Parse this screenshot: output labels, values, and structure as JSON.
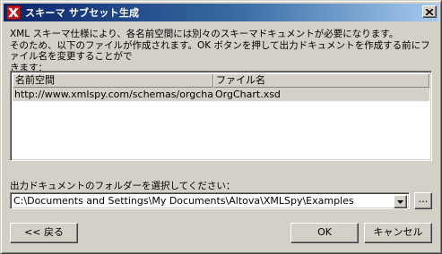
{
  "window": {
    "title": "スキーマ サブセット生成",
    "icon": "xmlspy-app-icon",
    "close_icon": "close-icon"
  },
  "description": "XML スキーマ仕様により、各名前空間には別々のスキーマドキュメントが必要になります。\nそのため、以下のファイルが作成されます。OK ボタンを押して出力ドキュメントを作成する前にファイル名を変更することがで\nきます：",
  "table": {
    "columns": [
      "名前空間",
      "ファイル名"
    ],
    "rows": [
      {
        "namespace": "http://www.xmlspy.com/schemas/orgchart",
        "filename": "OrgChart.xsd"
      }
    ]
  },
  "output": {
    "folder_label": "出力ドキュメントのフォルダーを選択してください：",
    "folder_value": "C:\\Documents and Settings\\My Documents\\Altova\\XMLSpy\\Examples",
    "browse_label": "..."
  },
  "buttons": {
    "back": "<< 戻る",
    "ok": "OK",
    "cancel": "キャンセル"
  }
}
